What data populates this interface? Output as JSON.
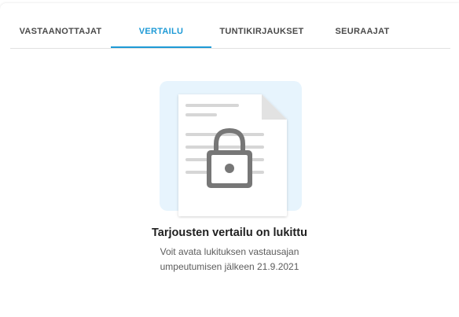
{
  "tabs": [
    {
      "label": "VASTAANOTTAJAT",
      "active": false
    },
    {
      "label": "VERTAILU",
      "active": true
    },
    {
      "label": "TUNTIKIRJAUKSET",
      "active": false
    },
    {
      "label": "SEURAAJAT",
      "active": false
    }
  ],
  "empty_state": {
    "illustration_icon": "locked-document-icon",
    "title": "Tarjousten vertailu on lukittu",
    "description_line1": "Voit avata lukituksen vastausajan",
    "description_line2": "umpeutumisen jälkeen 21.9.2021"
  },
  "colors": {
    "accent": "#1e9ad6",
    "illustration_bg": "#e7f4fd",
    "lock": "#7a7a7a"
  }
}
